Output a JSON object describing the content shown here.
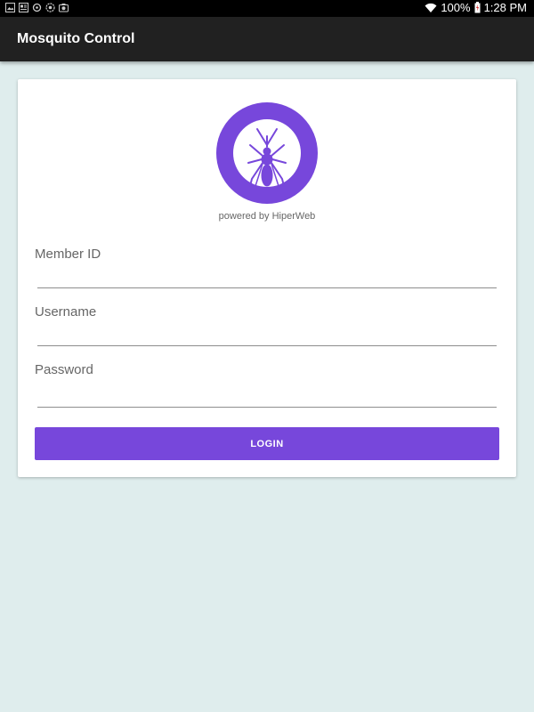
{
  "status_bar": {
    "battery": "100%",
    "time": "1:28 PM",
    "icons": [
      "image-icon",
      "news-icon",
      "sync-icon",
      "settings-icon",
      "camera-icon",
      "wifi-icon",
      "battery-icon"
    ]
  },
  "app_bar": {
    "title": "Mosquito Control"
  },
  "login": {
    "logo_icon": "mosquito-icon",
    "powered_by": "powered by HiperWeb",
    "member_id_label": "Member ID",
    "member_id_value": "",
    "username_label": "Username",
    "username_value": "",
    "password_label": "Password",
    "password_value": "",
    "login_button": "LOGIN"
  },
  "colors": {
    "accent": "#7747db",
    "app_bar": "#212121",
    "background": "#dfeded",
    "status_bar": "#000000"
  }
}
